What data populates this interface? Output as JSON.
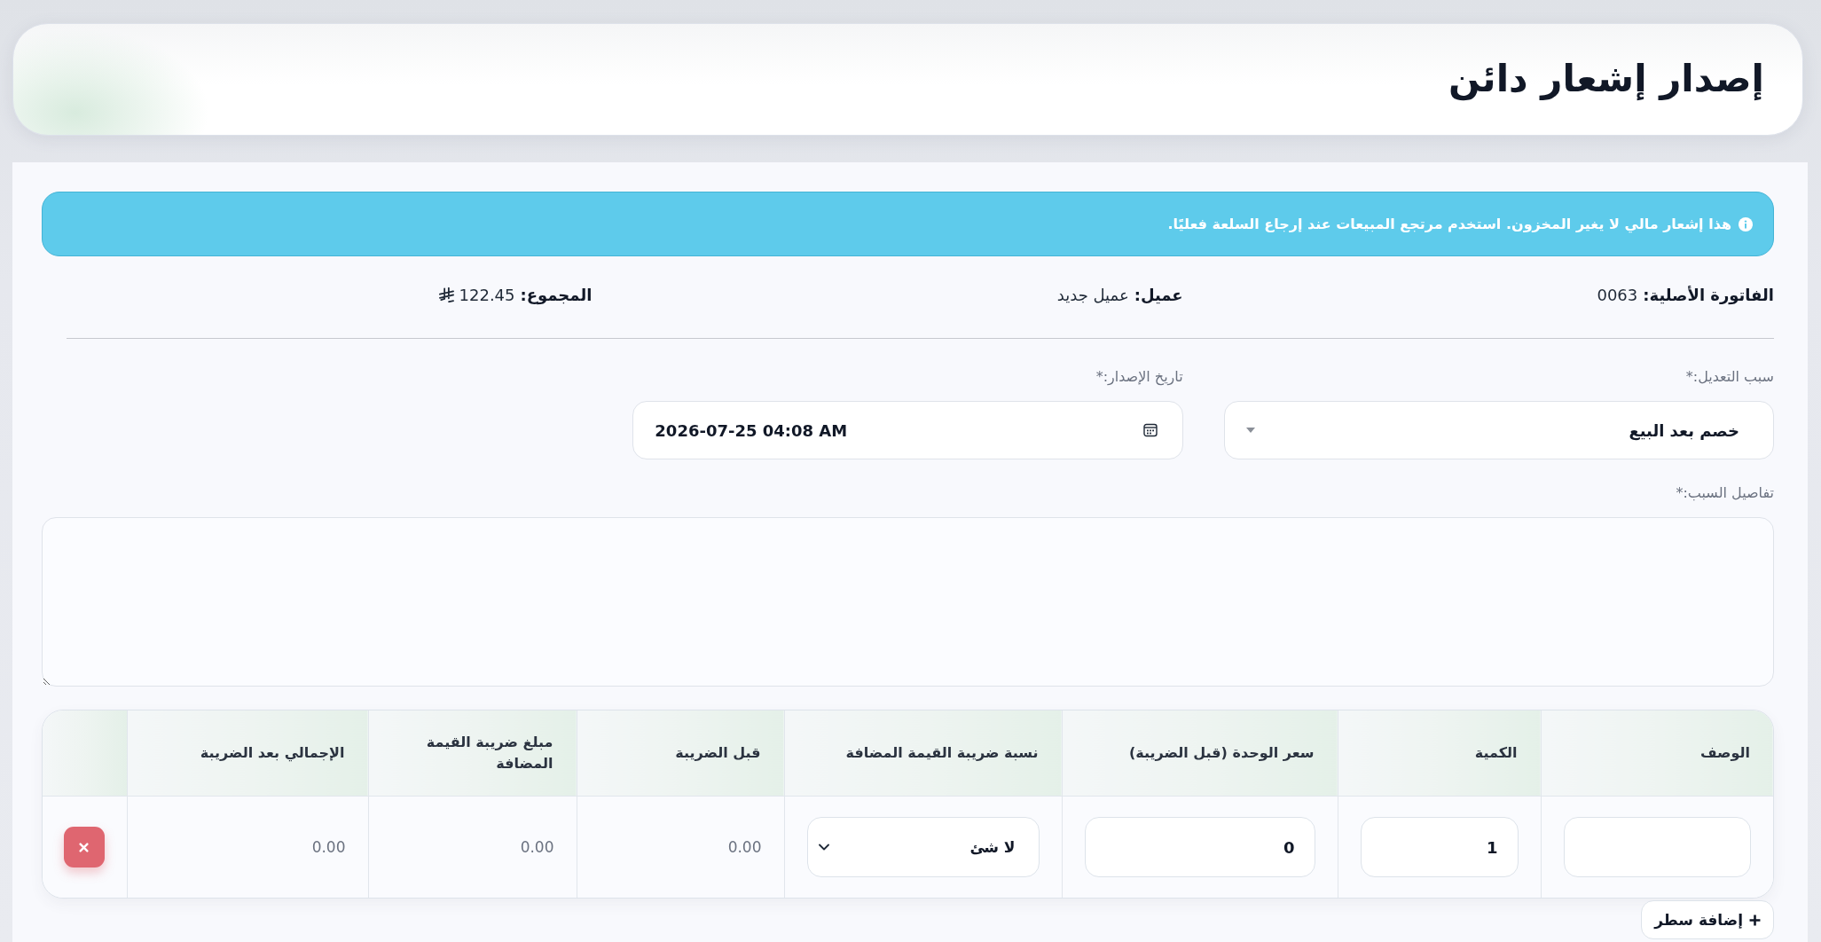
{
  "header": {
    "title": "إصدار إشعار دائن"
  },
  "notice": {
    "text": "هذا إشعار مالي لا يغير المخزون. استخدم مرتجع المبيعات عند إرجاع السلعة فعليًا."
  },
  "summary": [
    {
      "kind": "plain",
      "label": "الفاتورة الأصلية:",
      "value": "0063"
    },
    {
      "kind": "plain",
      "label": "عميل:",
      "value": "عميل جديد"
    },
    {
      "kind": "currency",
      "label": "المجموع:",
      "value": "122.45"
    }
  ],
  "form": {
    "fields": [
      {
        "kind": "select",
        "label": "سبب التعديل:*",
        "value": "خصم بعد البيع"
      },
      {
        "kind": "datetime",
        "label": "تاريخ الإصدار:*",
        "value": "2026-07-25 04:08 AM"
      }
    ],
    "details": {
      "label": "تفاصيل السبب:*"
    }
  },
  "table": {
    "columns": [
      "الوصف",
      "الكمية",
      "سعر الوحدة (قبل الضريبة)",
      "نسبة ضريبة القيمة المضافة",
      "قبل الضريبة",
      "مبلغ ضريبة القيمة المضافة",
      "الإجمالي بعد الضريبة"
    ],
    "rows": [
      {
        "cells": [
          {
            "kind": "input"
          },
          {
            "kind": "input",
            "value": "1"
          },
          {
            "kind": "input",
            "value": "0"
          },
          {
            "kind": "select",
            "value": "لا شئ"
          },
          {
            "kind": "amount",
            "value": "0.00"
          },
          {
            "kind": "amount",
            "value": "0.00"
          },
          {
            "kind": "amount",
            "value": "0.00"
          }
        ]
      }
    ]
  },
  "add_row_button": {
    "label": "إضافة سطر"
  }
}
